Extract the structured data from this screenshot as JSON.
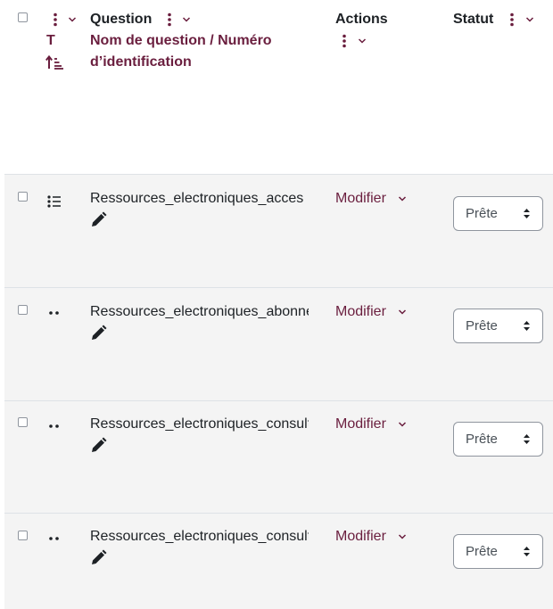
{
  "header": {
    "type_letter": "T",
    "question_label": "Question",
    "sort_name_label": "Nom de question / Numéro",
    "sort_id_label": "d’identification",
    "actions_label": "Actions",
    "status_label": "Statut"
  },
  "rows": [
    {
      "name": "Ressources_electroniques_acces",
      "action_label": "Modifier",
      "status": "Prête",
      "type_icon": "multichoice-list-icon"
    },
    {
      "name": "Ressources_electroniques_abonnement",
      "action_label": "Modifier",
      "status": "Prête",
      "type_icon": "two-dots-icon"
    },
    {
      "name": "Ressources_electroniques_consultation",
      "action_label": "Modifier",
      "status": "Prête",
      "type_icon": "two-dots-icon"
    },
    {
      "name": "Ressources_electroniques_consultation",
      "action_label": "Modifier",
      "status": "Prête",
      "type_icon": "two-dots-icon"
    }
  ],
  "colors": {
    "accent": "#6a1e3e",
    "row_background": "#f4f4f4",
    "border": "#dee2e6"
  }
}
